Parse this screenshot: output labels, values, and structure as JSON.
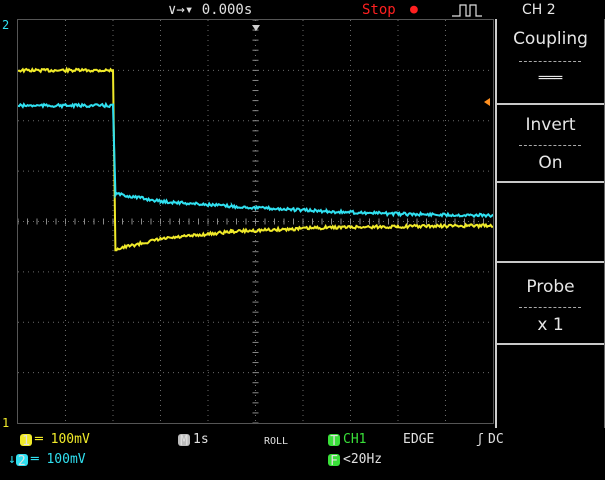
{
  "header": {
    "timebase_offset": "∨→▾ 0.000s",
    "run_state": "Stop",
    "run_dot": "●",
    "channel": "CH 2"
  },
  "menu": {
    "coupling_label": "Coupling",
    "coupling_value": "═══",
    "invert_label": "Invert",
    "invert_value": "On",
    "probe_label": "Probe",
    "probe_value": "x 1"
  },
  "status": {
    "ch1_scale": "═ 100mV",
    "ch2_scale": "═ 100mV",
    "ch1_badge": "1",
    "ch2_badge": "2",
    "ch2_arrow": "↓",
    "timebase_badge": "M",
    "timebase": "1s",
    "mode": "ROLL",
    "trig_source_badge": "T",
    "trig_source": "CH1",
    "trig_type": "EDGE",
    "trig_slope": "ʃ",
    "trig_coupling": "DC",
    "freq_badge": "F",
    "freq": "<20Hz"
  },
  "markers": {
    "ch2_ground": "2",
    "ch1_ground": "1"
  },
  "colors": {
    "ch1": "#f0ea2a",
    "ch2": "#30e0f0",
    "trigger": "#ff9020",
    "grid": "#6a6a6a"
  },
  "chart_data": {
    "type": "line",
    "x_divisions": 10,
    "y_divisions": 8,
    "series": [
      {
        "name": "CH1",
        "points": [
          [
            0,
            3.0
          ],
          [
            2.0,
            3.0
          ],
          [
            2.05,
            -0.55
          ],
          [
            3.0,
            -0.35
          ],
          [
            4.5,
            -0.2
          ],
          [
            6.5,
            -0.12
          ],
          [
            8.0,
            -0.1
          ],
          [
            10.0,
            -0.08
          ]
        ]
      },
      {
        "name": "CH2",
        "points": [
          [
            0,
            2.3
          ],
          [
            2.0,
            2.3
          ],
          [
            2.05,
            0.55
          ],
          [
            3.0,
            0.4
          ],
          [
            4.5,
            0.3
          ],
          [
            6.5,
            0.2
          ],
          [
            8.0,
            0.15
          ],
          [
            10.0,
            0.12
          ]
        ]
      }
    ]
  }
}
